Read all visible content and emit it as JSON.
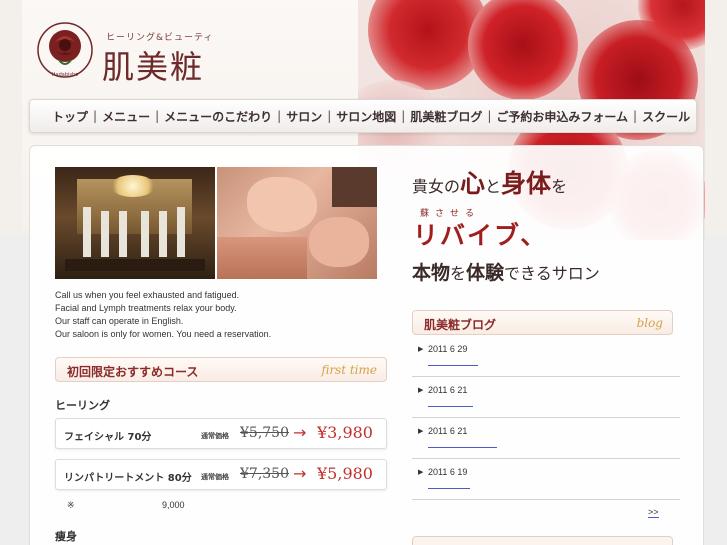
{
  "brand": {
    "subtitle": "ヒーリング&ビューティ",
    "name": "肌美粧",
    "emblem_text": "Hadabisho"
  },
  "nav": {
    "items": [
      "トップ",
      "メニュー",
      "メニューのこだわり",
      "サロン",
      "サロン地図",
      "肌美粧ブログ",
      "ご予約お申込みフォーム",
      "スクール"
    ],
    "separator": "|"
  },
  "intro": {
    "lines": [
      "Call us when you feel exhausted and fatigued.",
      "Facial and Lymph treatments relax your body.",
      "Our staff can operate in English.",
      "Our saloon is only for women. You need a reservation."
    ]
  },
  "course_box": {
    "title": "初回限定おすすめコース",
    "title_en": "first time"
  },
  "sections": {
    "healing": "ヒーリング",
    "slimming": "痩身"
  },
  "prices": [
    {
      "name": "フェイシャル 70分",
      "regular_label": "通常価格",
      "old": "¥5,750",
      "arrow": "→",
      "new": "¥3,980"
    },
    {
      "name": "リンパトリートメント 80分",
      "regular_label": "通常価格",
      "old": "¥7,350",
      "arrow": "→",
      "new": "¥5,980"
    }
  ],
  "note": {
    "mark": "※",
    "value": "9,000"
  },
  "tagline": {
    "pre1": "貴女の",
    "kokoro": "心",
    "to": "と",
    "karada": "身体",
    "wo": "を",
    "ruby": "蘇させる",
    "revive": "リバイブ、",
    "honmono": "本物",
    "wo2": "を",
    "taiken": "体験",
    "post": "できるサロン"
  },
  "blog": {
    "title": "肌美粧ブログ",
    "title_en": "blog",
    "entries": [
      {
        "date": "2011 6 29"
      },
      {
        "date": "2011 6 21"
      },
      {
        "date": "2011 6 21"
      },
      {
        "date": "2011 6 19"
      }
    ],
    "more": ">>"
  },
  "colors": {
    "accent": "#8a2a2a",
    "price": "#c0302e",
    "gold": "#d4a24a",
    "link": "#4a5bd0"
  }
}
